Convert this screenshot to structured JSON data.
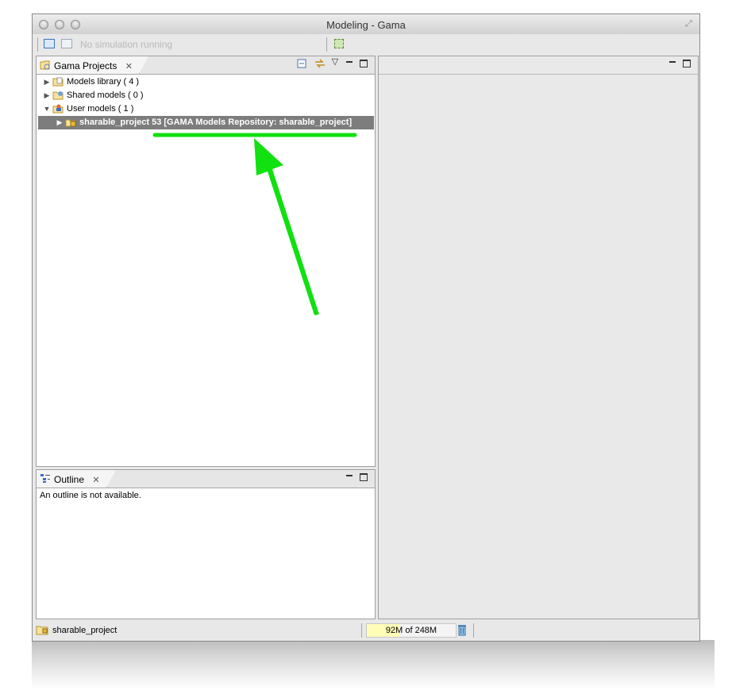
{
  "window": {
    "title": "Modeling - Gama"
  },
  "toolbar": {
    "simulation_status": "No simulation running"
  },
  "projects_panel": {
    "tab_label": "Gama Projects",
    "tree": [
      {
        "label": "Models library ( 4 )",
        "expanded": false
      },
      {
        "label": "Shared models ( 0 )",
        "expanded": false
      },
      {
        "label": "User models ( 1 )",
        "expanded": true
      },
      {
        "label": "sharable_project 53 [GAMA Models Repository: sharable_project]",
        "expanded": false,
        "selected": true,
        "level": 1
      }
    ]
  },
  "outline_panel": {
    "tab_label": "Outline",
    "message": "An outline is not available."
  },
  "status_bar": {
    "selected_item": "sharable_project",
    "memory": "92M of 248M",
    "memory_used_fraction": 0.37
  },
  "annotation": {
    "color": "#11e011"
  }
}
